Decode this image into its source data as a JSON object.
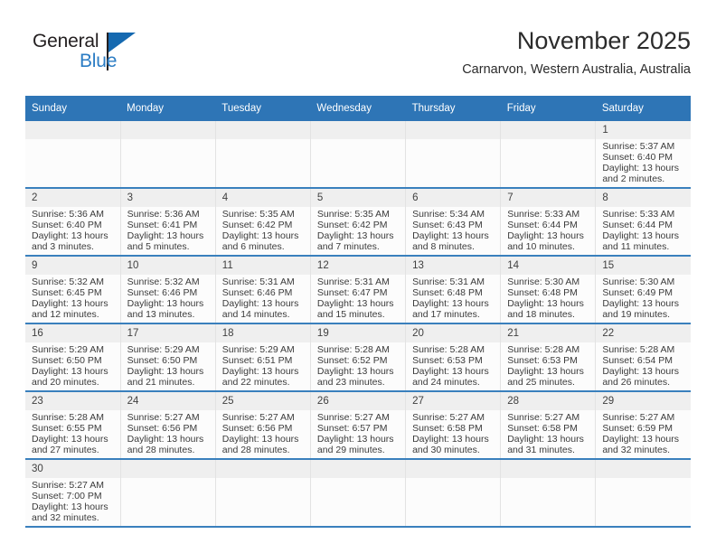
{
  "brand": {
    "word_top": "General",
    "word_bottom": "Blue",
    "flag_icon": "triangle-flag-icon",
    "accent_color": "#1569b0",
    "text_color": "#231f20"
  },
  "header": {
    "title": "November 2025",
    "location": "Carnarvon, Western Australia, Australia"
  },
  "calendar": {
    "header_bg": "#2e75b6",
    "row_separator_color": "#3a80bd",
    "daynum_bg": "#efefef",
    "weekdays": [
      "Sunday",
      "Monday",
      "Tuesday",
      "Wednesday",
      "Thursday",
      "Friday",
      "Saturday"
    ],
    "weeks": [
      [
        {
          "empty": true
        },
        {
          "empty": true
        },
        {
          "empty": true
        },
        {
          "empty": true
        },
        {
          "empty": true
        },
        {
          "empty": true
        },
        {
          "day": "1",
          "sunrise": "Sunrise: 5:37 AM",
          "sunset": "Sunset: 6:40 PM",
          "daylight_1": "Daylight: 13 hours",
          "daylight_2": "and 2 minutes."
        }
      ],
      [
        {
          "day": "2",
          "sunrise": "Sunrise: 5:36 AM",
          "sunset": "Sunset: 6:40 PM",
          "daylight_1": "Daylight: 13 hours",
          "daylight_2": "and 3 minutes."
        },
        {
          "day": "3",
          "sunrise": "Sunrise: 5:36 AM",
          "sunset": "Sunset: 6:41 PM",
          "daylight_1": "Daylight: 13 hours",
          "daylight_2": "and 5 minutes."
        },
        {
          "day": "4",
          "sunrise": "Sunrise: 5:35 AM",
          "sunset": "Sunset: 6:42 PM",
          "daylight_1": "Daylight: 13 hours",
          "daylight_2": "and 6 minutes."
        },
        {
          "day": "5",
          "sunrise": "Sunrise: 5:35 AM",
          "sunset": "Sunset: 6:42 PM",
          "daylight_1": "Daylight: 13 hours",
          "daylight_2": "and 7 minutes."
        },
        {
          "day": "6",
          "sunrise": "Sunrise: 5:34 AM",
          "sunset": "Sunset: 6:43 PM",
          "daylight_1": "Daylight: 13 hours",
          "daylight_2": "and 8 minutes."
        },
        {
          "day": "7",
          "sunrise": "Sunrise: 5:33 AM",
          "sunset": "Sunset: 6:44 PM",
          "daylight_1": "Daylight: 13 hours",
          "daylight_2": "and 10 minutes."
        },
        {
          "day": "8",
          "sunrise": "Sunrise: 5:33 AM",
          "sunset": "Sunset: 6:44 PM",
          "daylight_1": "Daylight: 13 hours",
          "daylight_2": "and 11 minutes."
        }
      ],
      [
        {
          "day": "9",
          "sunrise": "Sunrise: 5:32 AM",
          "sunset": "Sunset: 6:45 PM",
          "daylight_1": "Daylight: 13 hours",
          "daylight_2": "and 12 minutes."
        },
        {
          "day": "10",
          "sunrise": "Sunrise: 5:32 AM",
          "sunset": "Sunset: 6:46 PM",
          "daylight_1": "Daylight: 13 hours",
          "daylight_2": "and 13 minutes."
        },
        {
          "day": "11",
          "sunrise": "Sunrise: 5:31 AM",
          "sunset": "Sunset: 6:46 PM",
          "daylight_1": "Daylight: 13 hours",
          "daylight_2": "and 14 minutes."
        },
        {
          "day": "12",
          "sunrise": "Sunrise: 5:31 AM",
          "sunset": "Sunset: 6:47 PM",
          "daylight_1": "Daylight: 13 hours",
          "daylight_2": "and 15 minutes."
        },
        {
          "day": "13",
          "sunrise": "Sunrise: 5:31 AM",
          "sunset": "Sunset: 6:48 PM",
          "daylight_1": "Daylight: 13 hours",
          "daylight_2": "and 17 minutes."
        },
        {
          "day": "14",
          "sunrise": "Sunrise: 5:30 AM",
          "sunset": "Sunset: 6:48 PM",
          "daylight_1": "Daylight: 13 hours",
          "daylight_2": "and 18 minutes."
        },
        {
          "day": "15",
          "sunrise": "Sunrise: 5:30 AM",
          "sunset": "Sunset: 6:49 PM",
          "daylight_1": "Daylight: 13 hours",
          "daylight_2": "and 19 minutes."
        }
      ],
      [
        {
          "day": "16",
          "sunrise": "Sunrise: 5:29 AM",
          "sunset": "Sunset: 6:50 PM",
          "daylight_1": "Daylight: 13 hours",
          "daylight_2": "and 20 minutes."
        },
        {
          "day": "17",
          "sunrise": "Sunrise: 5:29 AM",
          "sunset": "Sunset: 6:50 PM",
          "daylight_1": "Daylight: 13 hours",
          "daylight_2": "and 21 minutes."
        },
        {
          "day": "18",
          "sunrise": "Sunrise: 5:29 AM",
          "sunset": "Sunset: 6:51 PM",
          "daylight_1": "Daylight: 13 hours",
          "daylight_2": "and 22 minutes."
        },
        {
          "day": "19",
          "sunrise": "Sunrise: 5:28 AM",
          "sunset": "Sunset: 6:52 PM",
          "daylight_1": "Daylight: 13 hours",
          "daylight_2": "and 23 minutes."
        },
        {
          "day": "20",
          "sunrise": "Sunrise: 5:28 AM",
          "sunset": "Sunset: 6:53 PM",
          "daylight_1": "Daylight: 13 hours",
          "daylight_2": "and 24 minutes."
        },
        {
          "day": "21",
          "sunrise": "Sunrise: 5:28 AM",
          "sunset": "Sunset: 6:53 PM",
          "daylight_1": "Daylight: 13 hours",
          "daylight_2": "and 25 minutes."
        },
        {
          "day": "22",
          "sunrise": "Sunrise: 5:28 AM",
          "sunset": "Sunset: 6:54 PM",
          "daylight_1": "Daylight: 13 hours",
          "daylight_2": "and 26 minutes."
        }
      ],
      [
        {
          "day": "23",
          "sunrise": "Sunrise: 5:28 AM",
          "sunset": "Sunset: 6:55 PM",
          "daylight_1": "Daylight: 13 hours",
          "daylight_2": "and 27 minutes."
        },
        {
          "day": "24",
          "sunrise": "Sunrise: 5:27 AM",
          "sunset": "Sunset: 6:56 PM",
          "daylight_1": "Daylight: 13 hours",
          "daylight_2": "and 28 minutes."
        },
        {
          "day": "25",
          "sunrise": "Sunrise: 5:27 AM",
          "sunset": "Sunset: 6:56 PM",
          "daylight_1": "Daylight: 13 hours",
          "daylight_2": "and 28 minutes."
        },
        {
          "day": "26",
          "sunrise": "Sunrise: 5:27 AM",
          "sunset": "Sunset: 6:57 PM",
          "daylight_1": "Daylight: 13 hours",
          "daylight_2": "and 29 minutes."
        },
        {
          "day": "27",
          "sunrise": "Sunrise: 5:27 AM",
          "sunset": "Sunset: 6:58 PM",
          "daylight_1": "Daylight: 13 hours",
          "daylight_2": "and 30 minutes."
        },
        {
          "day": "28",
          "sunrise": "Sunrise: 5:27 AM",
          "sunset": "Sunset: 6:58 PM",
          "daylight_1": "Daylight: 13 hours",
          "daylight_2": "and 31 minutes."
        },
        {
          "day": "29",
          "sunrise": "Sunrise: 5:27 AM",
          "sunset": "Sunset: 6:59 PM",
          "daylight_1": "Daylight: 13 hours",
          "daylight_2": "and 32 minutes."
        }
      ],
      [
        {
          "day": "30",
          "sunrise": "Sunrise: 5:27 AM",
          "sunset": "Sunset: 7:00 PM",
          "daylight_1": "Daylight: 13 hours",
          "daylight_2": "and 32 minutes."
        },
        {
          "empty": true
        },
        {
          "empty": true
        },
        {
          "empty": true
        },
        {
          "empty": true
        },
        {
          "empty": true
        },
        {
          "empty": true
        }
      ]
    ]
  }
}
